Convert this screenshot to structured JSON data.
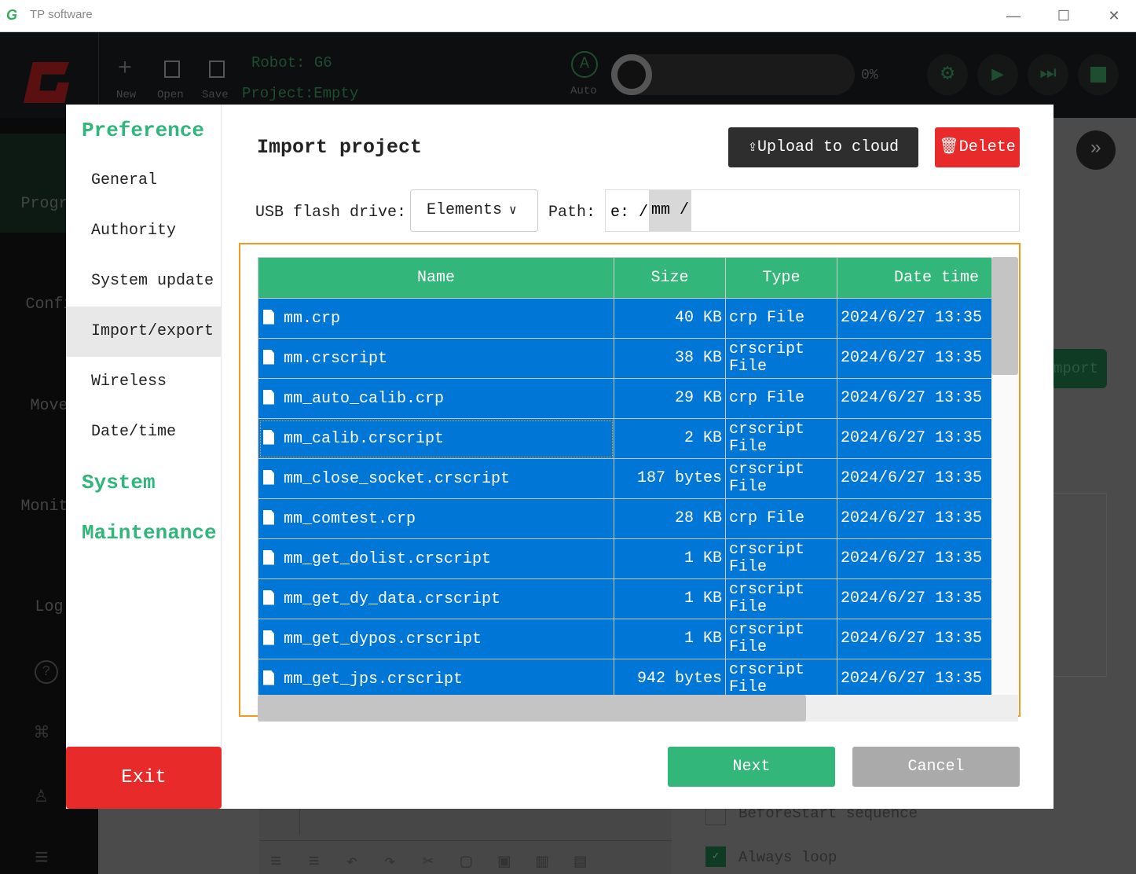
{
  "window": {
    "title": "TP software",
    "minimize": "—",
    "maximize": "☐",
    "close": "✕"
  },
  "toolbar": {
    "new": "New",
    "open": "Open",
    "save": "Save",
    "robot": "Robot: G6",
    "project": "Project:Empty",
    "mode": "Auto",
    "mode_letter": "A",
    "progress": "0%",
    "progress_value": 0
  },
  "sidebar": {
    "items": [
      "Progra",
      "Confi",
      "Move",
      "Monito",
      "Log"
    ]
  },
  "background": {
    "import_label": "mport",
    "before_start": "BeforeStart sequence",
    "always_loop": "Always loop",
    "always_loop_checked": true,
    "before_start_checked": false
  },
  "preferences": {
    "heading": "Preference",
    "items": [
      "General",
      "Authority",
      "System update",
      "Import/export",
      "Wireless",
      "Date/time"
    ],
    "active": "Import/export",
    "system": "System",
    "maintenance": "Maintenance",
    "exit": "Exit"
  },
  "import": {
    "title": "Import project",
    "upload": "Upload to cloud",
    "delete": "Delete",
    "usb_label": "USB flash drive:",
    "usb_value": "Elements",
    "path_label": "Path:",
    "path_root": "e: /",
    "path_seg": "mm /",
    "columns": [
      "Name",
      "Size",
      "Type",
      "Date time"
    ],
    "rows": [
      {
        "name": "mm.crp",
        "size": "40 KB",
        "type": "crp File",
        "date": "2024/6/27 13:35"
      },
      {
        "name": "mm.crscript",
        "size": "38 KB",
        "type": "crscript File",
        "date": "2024/6/27 13:35"
      },
      {
        "name": "mm_auto_calib.crp",
        "size": "29 KB",
        "type": "crp File",
        "date": "2024/6/27 13:35"
      },
      {
        "name": "mm_calib.crscript",
        "size": "2 KB",
        "type": "crscript File",
        "date": "2024/6/27 13:35"
      },
      {
        "name": "mm_close_socket.crscript",
        "size": "187 bytes",
        "type": "crscript File",
        "date": "2024/6/27 13:35"
      },
      {
        "name": "mm_comtest.crp",
        "size": "28 KB",
        "type": "crp File",
        "date": "2024/6/27 13:35"
      },
      {
        "name": "mm_get_dolist.crscript",
        "size": "1 KB",
        "type": "crscript File",
        "date": "2024/6/27 13:35"
      },
      {
        "name": "mm_get_dy_data.crscript",
        "size": "1 KB",
        "type": "crscript File",
        "date": "2024/6/27 13:35"
      },
      {
        "name": "mm_get_dypos.crscript",
        "size": "1 KB",
        "type": "crscript File",
        "date": "2024/6/27 13:35"
      },
      {
        "name": "mm_get_jps.crscript",
        "size": "942 bytes",
        "type": "crscript File",
        "date": "2024/6/27 13:35"
      }
    ],
    "next": "Next",
    "cancel": "Cancel"
  },
  "colors": {
    "accent": "#33b679",
    "row": "#0076d6",
    "danger": "#e82a2a",
    "focus": "#f29a1f"
  }
}
